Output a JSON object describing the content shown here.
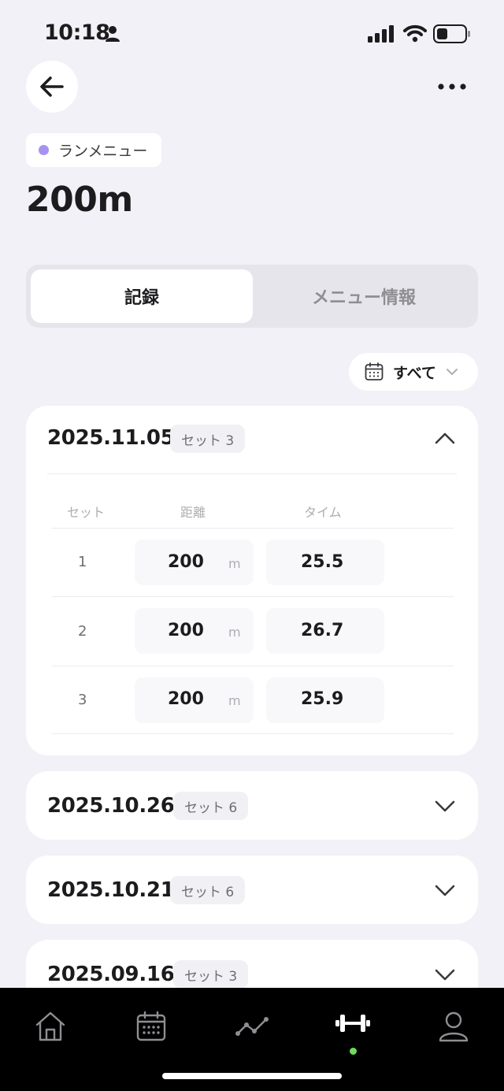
{
  "status_bar": {
    "time": "10:18"
  },
  "header": {
    "category": "ランメニュー",
    "title": "200m"
  },
  "tabs": [
    {
      "label": "記録"
    },
    {
      "label": "メニュー情報"
    }
  ],
  "filter": {
    "label": "すべて"
  },
  "table_headers": {
    "set": "セット",
    "distance": "距離",
    "time": "タイム"
  },
  "records": [
    {
      "date": "2025.11.05",
      "sets_label": "セット 3",
      "rows": [
        {
          "set": "1",
          "distance": "200",
          "unit": "m",
          "time": "25.5"
        },
        {
          "set": "2",
          "distance": "200",
          "unit": "m",
          "time": "26.7"
        },
        {
          "set": "3",
          "distance": "200",
          "unit": "m",
          "time": "25.9"
        }
      ]
    },
    {
      "date": "2025.10.26",
      "sets_label": "セット 6"
    },
    {
      "date": "2025.10.21",
      "sets_label": "セット 6"
    },
    {
      "date": "2025.09.16",
      "sets_label": "セット 3"
    }
  ],
  "colors": {
    "accent_dot": "#a892f0",
    "nav_active_dot": "#6fdc5a",
    "background": "#f1f1f7"
  },
  "nav": {
    "items": [
      {
        "icon": "home-icon"
      },
      {
        "icon": "calendar-icon"
      },
      {
        "icon": "chart-icon"
      },
      {
        "icon": "dumbbell-icon",
        "active": true
      },
      {
        "icon": "profile-icon"
      }
    ]
  }
}
